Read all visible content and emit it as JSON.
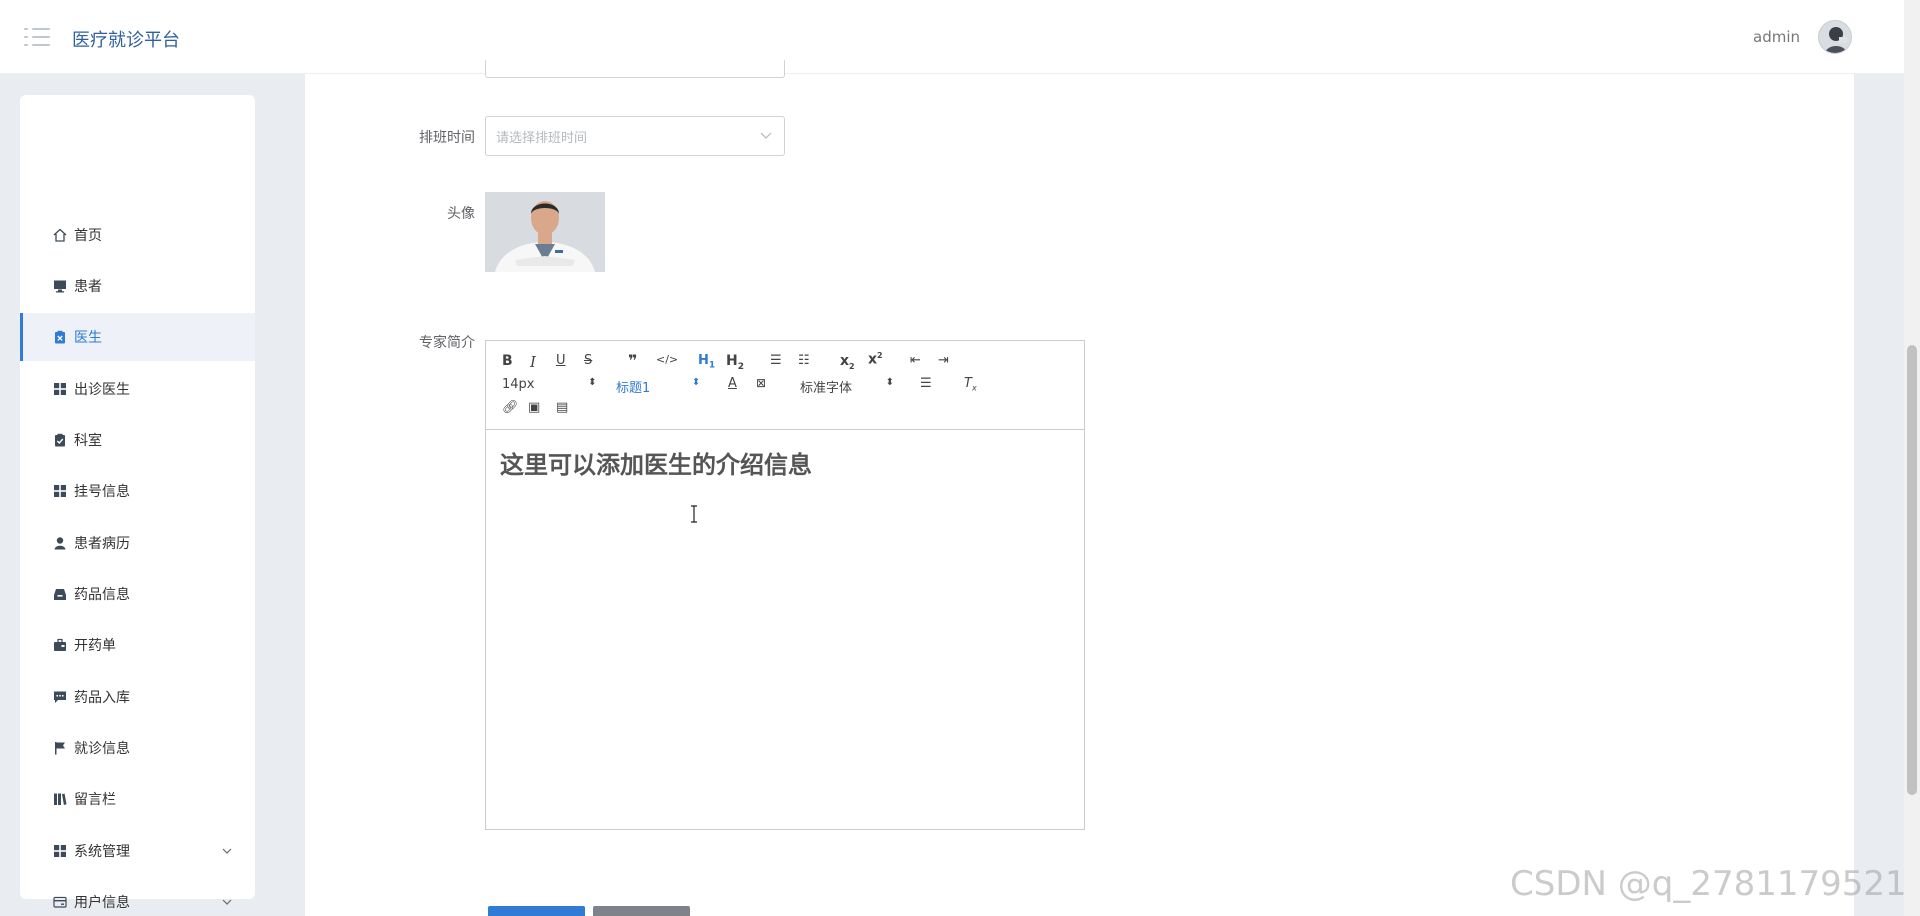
{
  "header": {
    "brand": "医疗就诊平台",
    "user_name": "admin"
  },
  "sidebar": {
    "items": [
      {
        "label": "首页",
        "icon": "home-icon"
      },
      {
        "label": "患者",
        "icon": "monitor-icon"
      },
      {
        "label": "医生",
        "icon": "clipboard-x-icon",
        "active": true
      },
      {
        "label": "出诊医生",
        "icon": "grid-icon"
      },
      {
        "label": "科室",
        "icon": "clipboard-check-icon"
      },
      {
        "label": "挂号信息",
        "icon": "grid-icon"
      },
      {
        "label": "患者病历",
        "icon": "user-icon"
      },
      {
        "label": "药品信息",
        "icon": "inbox-icon"
      },
      {
        "label": "开药单",
        "icon": "briefcase-icon"
      },
      {
        "label": "药品入库",
        "icon": "chat-icon"
      },
      {
        "label": "就诊信息",
        "icon": "flag-icon"
      },
      {
        "label": "留言栏",
        "icon": "library-icon"
      },
      {
        "label": "系统管理",
        "icon": "grid-icon",
        "expandable": true
      },
      {
        "label": "用户信息",
        "icon": "card-icon",
        "expandable": true
      }
    ]
  },
  "form": {
    "schedule_label": "排班时间",
    "schedule_placeholder": "请选择排班时间",
    "avatar_label": "头像",
    "intro_label": "专家简介"
  },
  "editor": {
    "font_size": "14px",
    "heading": "标题1",
    "font_family": "标准字体",
    "content": "这里可以添加医生的介绍信息"
  },
  "watermark": "CSDN @q_2781179521",
  "colors": {
    "brand": "#2f5f9e",
    "accent": "#2f7bd6"
  }
}
